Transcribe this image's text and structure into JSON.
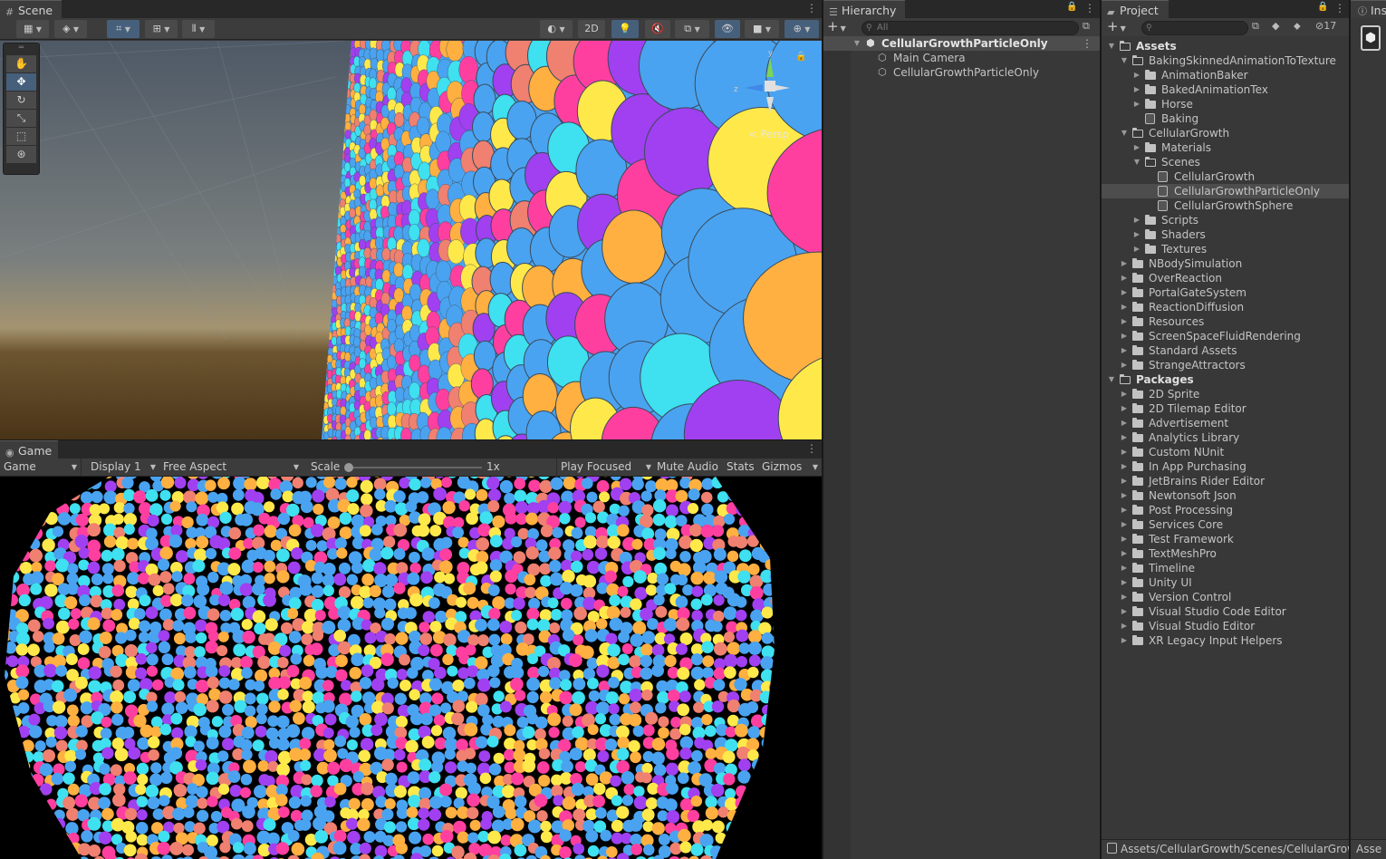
{
  "scene": {
    "tab": "Scene",
    "toolbar": {
      "btn_2d": "2D",
      "persp": "Persp"
    }
  },
  "game": {
    "tab": "Game",
    "mode": "Game",
    "display": "Display 1",
    "aspect": "Free Aspect",
    "scale_label": "Scale",
    "scale_value": "1x",
    "play_focused": "Play Focused",
    "mute": "Mute Audio",
    "stats": "Stats",
    "gizmos": "Gizmos"
  },
  "hierarchy": {
    "tab": "Hierarchy",
    "search_placeholder": "All",
    "root": "CellularGrowthParticleOnly",
    "children": [
      "Main Camera",
      "CellularGrowthParticleOnly"
    ]
  },
  "project": {
    "tab": "Project",
    "hidden_count": "17",
    "status_path": "Assets/CellularGrowth/Scenes/CellularGrow",
    "rows": [
      {
        "label": "Assets",
        "depth": 0,
        "type": "folder-open",
        "arrow": "down",
        "bold": true
      },
      {
        "label": "BakingSkinnedAnimationToTexture",
        "depth": 1,
        "type": "folder-open",
        "arrow": "down"
      },
      {
        "label": "AnimationBaker",
        "depth": 2,
        "type": "folder",
        "arrow": "right"
      },
      {
        "label": "BakedAnimationTex",
        "depth": 2,
        "type": "folder",
        "arrow": "right"
      },
      {
        "label": "Horse",
        "depth": 2,
        "type": "folder",
        "arrow": "right"
      },
      {
        "label": "Baking",
        "depth": 2,
        "type": "scene",
        "arrow": ""
      },
      {
        "label": "CellularGrowth",
        "depth": 1,
        "type": "folder-open",
        "arrow": "down"
      },
      {
        "label": "Materials",
        "depth": 2,
        "type": "folder",
        "arrow": "right"
      },
      {
        "label": "Scenes",
        "depth": 2,
        "type": "folder-open",
        "arrow": "down"
      },
      {
        "label": "CellularGrowth",
        "depth": 3,
        "type": "scene",
        "arrow": ""
      },
      {
        "label": "CellularGrowthParticleOnly",
        "depth": 3,
        "type": "scene",
        "arrow": "",
        "selected": true
      },
      {
        "label": "CellularGrowthSphere",
        "depth": 3,
        "type": "scene",
        "arrow": ""
      },
      {
        "label": "Scripts",
        "depth": 2,
        "type": "folder",
        "arrow": "right"
      },
      {
        "label": "Shaders",
        "depth": 2,
        "type": "folder",
        "arrow": "right"
      },
      {
        "label": "Textures",
        "depth": 2,
        "type": "folder",
        "arrow": "right"
      },
      {
        "label": "NBodySimulation",
        "depth": 1,
        "type": "folder",
        "arrow": "right"
      },
      {
        "label": "OverReaction",
        "depth": 1,
        "type": "folder",
        "arrow": "right"
      },
      {
        "label": "PortalGateSystem",
        "depth": 1,
        "type": "folder",
        "arrow": "right"
      },
      {
        "label": "ReactionDiffusion",
        "depth": 1,
        "type": "folder",
        "arrow": "right"
      },
      {
        "label": "Resources",
        "depth": 1,
        "type": "folder",
        "arrow": "right"
      },
      {
        "label": "ScreenSpaceFluidRendering",
        "depth": 1,
        "type": "folder",
        "arrow": "right"
      },
      {
        "label": "Standard Assets",
        "depth": 1,
        "type": "folder",
        "arrow": "right"
      },
      {
        "label": "StrangeAttractors",
        "depth": 1,
        "type": "folder",
        "arrow": "right"
      },
      {
        "label": "Packages",
        "depth": 0,
        "type": "folder-open",
        "arrow": "down",
        "bold": true
      },
      {
        "label": "2D Sprite",
        "depth": 1,
        "type": "folder",
        "arrow": "right"
      },
      {
        "label": "2D Tilemap Editor",
        "depth": 1,
        "type": "folder",
        "arrow": "right"
      },
      {
        "label": "Advertisement",
        "depth": 1,
        "type": "folder",
        "arrow": "right"
      },
      {
        "label": "Analytics Library",
        "depth": 1,
        "type": "folder",
        "arrow": "right"
      },
      {
        "label": "Custom NUnit",
        "depth": 1,
        "type": "folder",
        "arrow": "right"
      },
      {
        "label": "In App Purchasing",
        "depth": 1,
        "type": "folder",
        "arrow": "right"
      },
      {
        "label": "JetBrains Rider Editor",
        "depth": 1,
        "type": "folder",
        "arrow": "right"
      },
      {
        "label": "Newtonsoft Json",
        "depth": 1,
        "type": "folder",
        "arrow": "right"
      },
      {
        "label": "Post Processing",
        "depth": 1,
        "type": "folder",
        "arrow": "right"
      },
      {
        "label": "Services Core",
        "depth": 1,
        "type": "folder",
        "arrow": "right"
      },
      {
        "label": "Test Framework",
        "depth": 1,
        "type": "folder",
        "arrow": "right"
      },
      {
        "label": "TextMeshPro",
        "depth": 1,
        "type": "folder",
        "arrow": "right"
      },
      {
        "label": "Timeline",
        "depth": 1,
        "type": "folder",
        "arrow": "right"
      },
      {
        "label": "Unity UI",
        "depth": 1,
        "type": "folder",
        "arrow": "right"
      },
      {
        "label": "Version Control",
        "depth": 1,
        "type": "folder",
        "arrow": "right"
      },
      {
        "label": "Visual Studio Code Editor",
        "depth": 1,
        "type": "folder",
        "arrow": "right"
      },
      {
        "label": "Visual Studio Editor",
        "depth": 1,
        "type": "folder",
        "arrow": "right"
      },
      {
        "label": "XR Legacy Input Helpers",
        "depth": 1,
        "type": "folder",
        "arrow": "right"
      }
    ]
  },
  "inspector": {
    "tab": "Ins",
    "status": "Asse"
  },
  "colors": {
    "cells": [
      "#4aa3f0",
      "#4aa3f0",
      "#4aa3f0",
      "#3fe0f0",
      "#ffe94a",
      "#ffb040",
      "#a040f0",
      "#ff3fa0",
      "#f08070"
    ],
    "selection": "#2c5d87",
    "active_tool": "#46607c"
  }
}
